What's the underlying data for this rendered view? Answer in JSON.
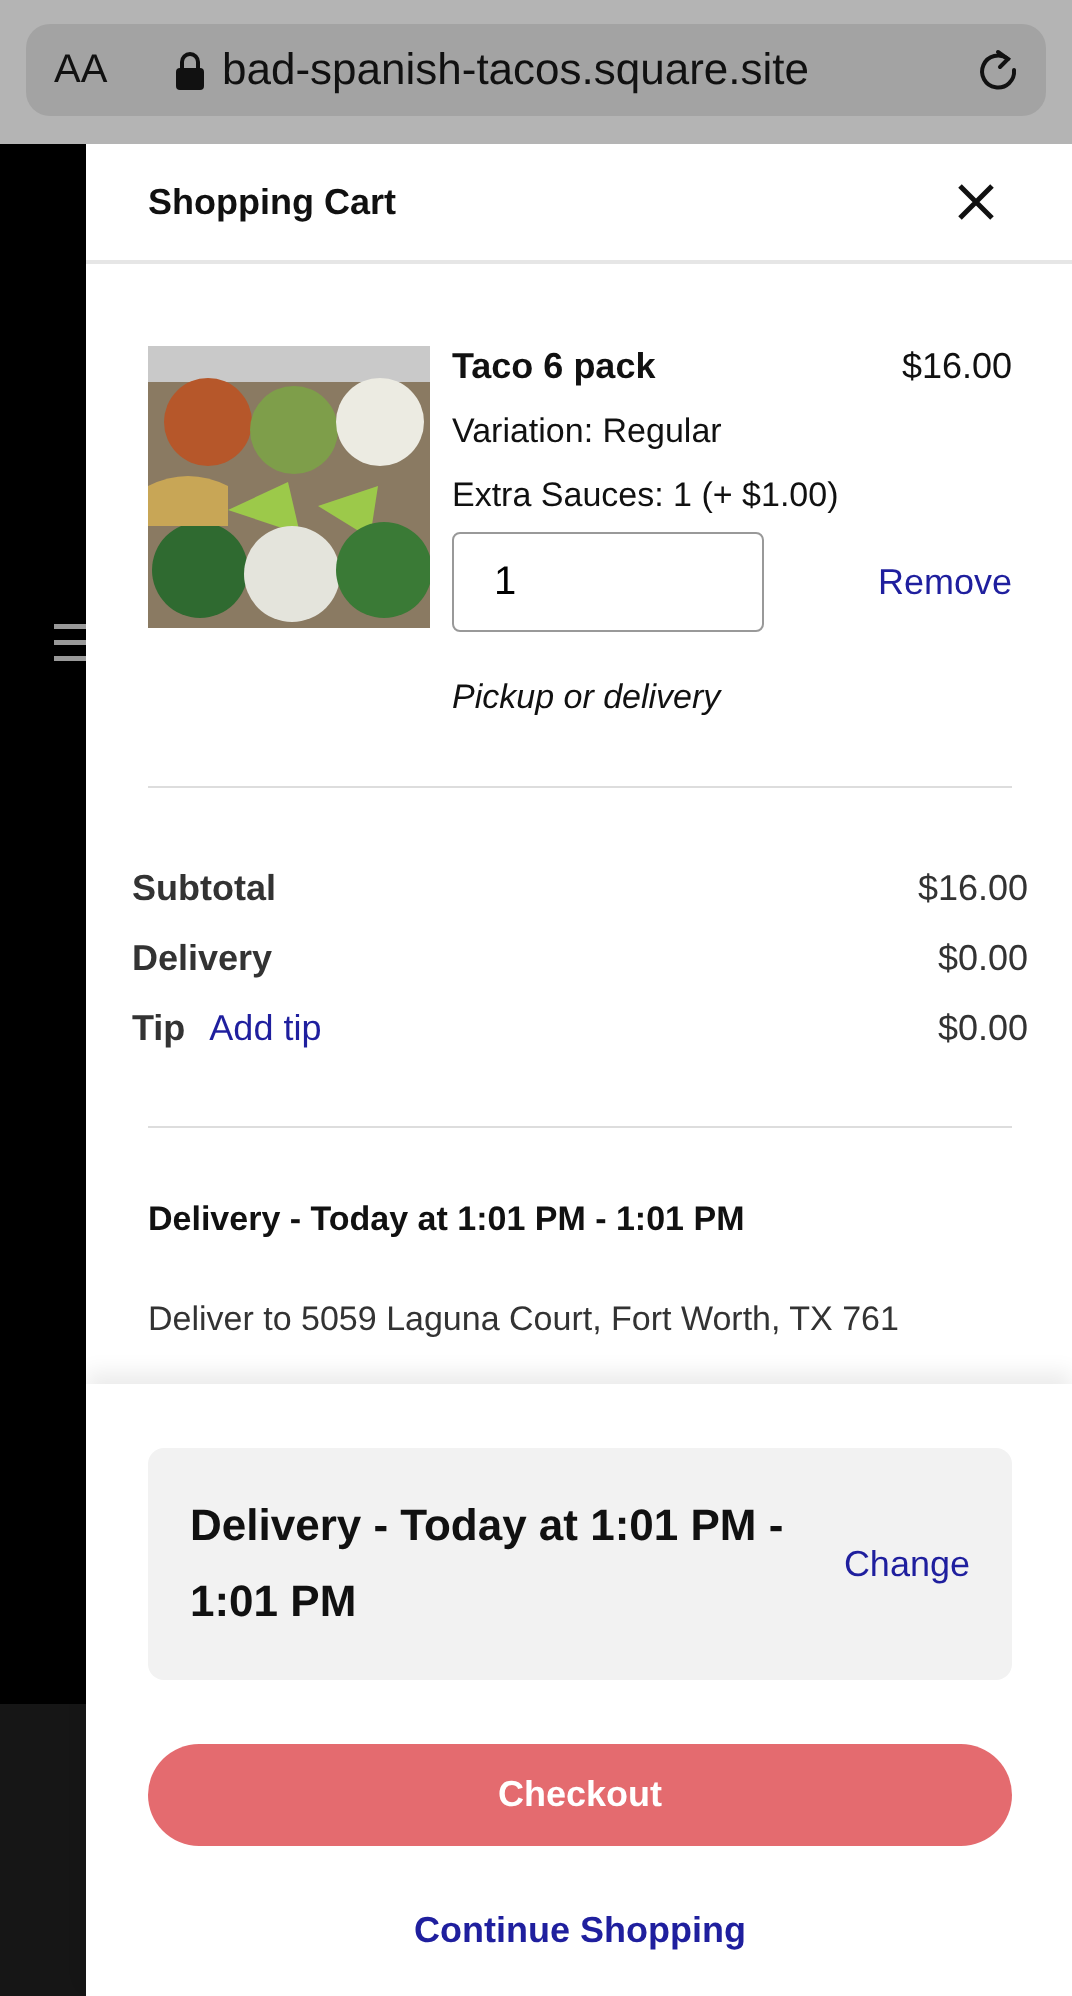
{
  "browser": {
    "text_size": "AA",
    "url": "bad-spanish-tacos.square.site"
  },
  "cart": {
    "title": "Shopping Cart",
    "items": [
      {
        "name": "Taco 6 pack",
        "price": "$16.00",
        "options": [
          "Variation: Regular",
          "Extra Sauces: 1 (+ $1.00)"
        ],
        "quantity": "1",
        "remove": "Remove",
        "fulfillment": "Pickup or delivery"
      }
    ],
    "totals": [
      {
        "label": "Subtotal",
        "value": "$16.00"
      },
      {
        "label": "Delivery",
        "value": "$0.00"
      },
      {
        "label": "Tip",
        "link": "Add tip",
        "value": "$0.00"
      }
    ],
    "delivery_heading": "Delivery - Today at 1:01 PM - 1:01 PM",
    "delivery_address": "Deliver to 5059 Laguna Court, Fort Worth, TX 761"
  },
  "footer": {
    "delivery_time": "Delivery - Today at 1:01 PM - 1:01 PM",
    "change": "Change",
    "checkout": "Checkout",
    "continue": "Continue Shopping"
  }
}
